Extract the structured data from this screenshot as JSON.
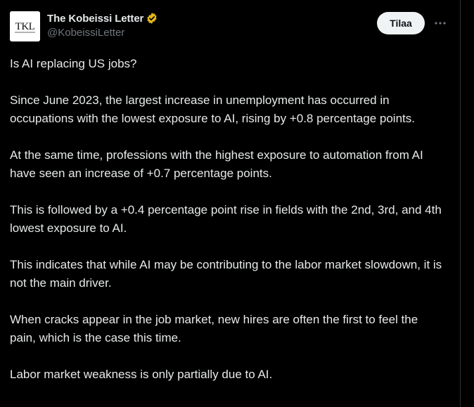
{
  "author": {
    "display_name": "The Kobeissi Letter",
    "handle": "@KobeissiLetter",
    "avatar_text": "TKL",
    "verified_badge_color": "#f4b400"
  },
  "actions": {
    "subscribe_label": "Tilaa",
    "more_icon": "more-horizontal-icon"
  },
  "post": {
    "paragraphs": [
      "Is AI replacing US jobs?",
      "Since June 2023, the largest increase in unemployment has occurred in occupations with the lowest exposure to AI, rising by +0.8 percentage points.",
      "At the same time, professions with the highest exposure to automation from AI have seen an increase of +0.7 percentage points.",
      "This is followed by a +0.4 percentage point rise in fields with the 2nd, 3rd, and 4th lowest exposure to AI.",
      "This indicates that while AI may be contributing to the labor market slowdown, it is not the main driver.",
      "When cracks appear in the job market, new hires are often the first to feel the pain, which is the case this time.",
      "Labor market weakness is only partially due to AI."
    ]
  },
  "colors": {
    "background": "#000000",
    "text_primary": "#e7e9ea",
    "text_secondary": "#71767b",
    "button_bg": "#eff3f4",
    "button_text": "#0f1419"
  }
}
